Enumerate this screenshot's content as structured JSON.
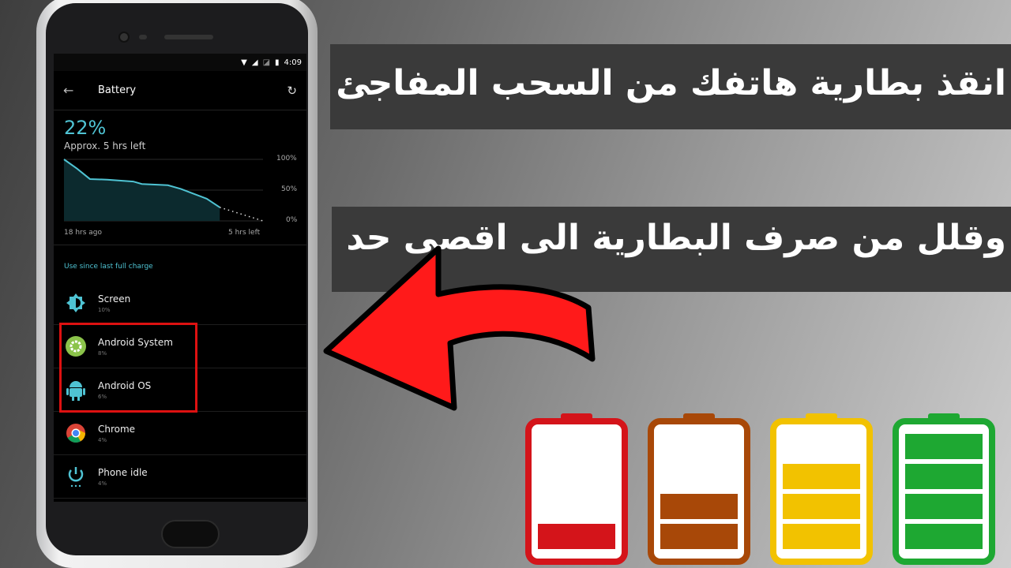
{
  "headline": {
    "line1": "انقذ بطارية هاتفك من السحب المفاجئ",
    "line2": "وقلل من صرف البطارية الى اقصى حد"
  },
  "status_bar": {
    "time": "4:09",
    "icons": [
      "wifi-icon",
      "signal-icon",
      "no-sim-icon",
      "battery-icon"
    ]
  },
  "app_bar": {
    "back_icon": "arrow-left-icon",
    "title": "Battery",
    "refresh_icon": "refresh-icon"
  },
  "battery": {
    "percent": "22%",
    "estimate": "Approx. 5 hrs left"
  },
  "chart_data": {
    "type": "line",
    "x_unit": "hours",
    "x": [
      -18,
      -16.5,
      -15,
      -13,
      -10,
      -9,
      -6,
      -4.5,
      -3,
      -1.5,
      0
    ],
    "values": [
      100,
      85,
      68,
      67,
      64,
      60,
      58,
      52,
      44,
      36,
      22
    ],
    "projection": {
      "x": [
        0,
        5
      ],
      "values": [
        22,
        0
      ]
    },
    "ylim": [
      0,
      100
    ],
    "yticks": [
      "100%",
      "50%",
      "0%"
    ],
    "xtick_start": "18 hrs ago",
    "xtick_end": "5 hrs left",
    "color": "#4fc3d3"
  },
  "section_label": "Use since last full charge",
  "usage": [
    {
      "name": "Screen",
      "percent": "10%",
      "icon": "brightness-icon"
    },
    {
      "name": "Android System",
      "percent": "8%",
      "icon": "gear-icon"
    },
    {
      "name": "Android OS",
      "percent": "6%",
      "icon": "android-icon"
    },
    {
      "name": "Chrome",
      "percent": "4%",
      "icon": "chrome-icon"
    },
    {
      "name": "Phone idle",
      "percent": "4%",
      "icon": "power-icon"
    }
  ],
  "batteries": [
    {
      "color": "#d4141a",
      "level": 1,
      "of": 4
    },
    {
      "color": "#a84808",
      "level": 2,
      "of": 4
    },
    {
      "color": "#f2c200",
      "level": 3,
      "of": 4
    },
    {
      "color": "#1ea832",
      "level": 4,
      "of": 4
    }
  ],
  "colors": {
    "accent": "#4fc3d3",
    "highlight": "#dd1111",
    "arrow": "#ff1a1a"
  }
}
